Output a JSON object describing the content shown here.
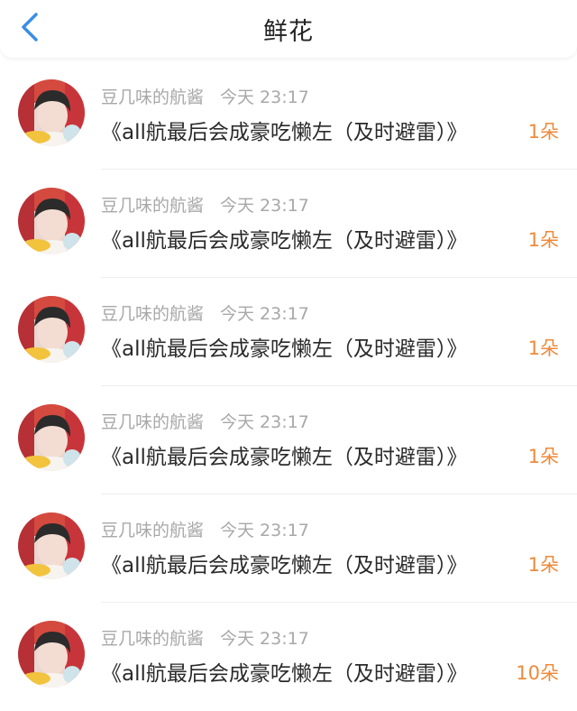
{
  "header": {
    "back_icon": "chevron-left-icon",
    "title": "鲜花"
  },
  "colors": {
    "accent_blue": "#3a8ee6",
    "flower_count": "#ee8a3a",
    "meta_gray": "#a8a8a8"
  },
  "items": [
    {
      "user": "豆几味的航酱",
      "time": "今天 23:17",
      "work": "《all航最后会成豪吃懒左（及时避雷）》",
      "count": "1朵"
    },
    {
      "user": "豆几味的航酱",
      "time": "今天 23:17",
      "work": "《all航最后会成豪吃懒左（及时避雷）》",
      "count": "1朵"
    },
    {
      "user": "豆几味的航酱",
      "time": "今天 23:17",
      "work": "《all航最后会成豪吃懒左（及时避雷）》",
      "count": "1朵"
    },
    {
      "user": "豆几味的航酱",
      "time": "今天 23:17",
      "work": "《all航最后会成豪吃懒左（及时避雷）》",
      "count": "1朵"
    },
    {
      "user": "豆几味的航酱",
      "time": "今天 23:17",
      "work": "《all航最后会成豪吃懒左（及时避雷）》",
      "count": "1朵"
    },
    {
      "user": "豆几味的航酱",
      "time": "今天 23:17",
      "work": "《all航最后会成豪吃懒左（及时避雷）》",
      "count": "10朵"
    }
  ]
}
